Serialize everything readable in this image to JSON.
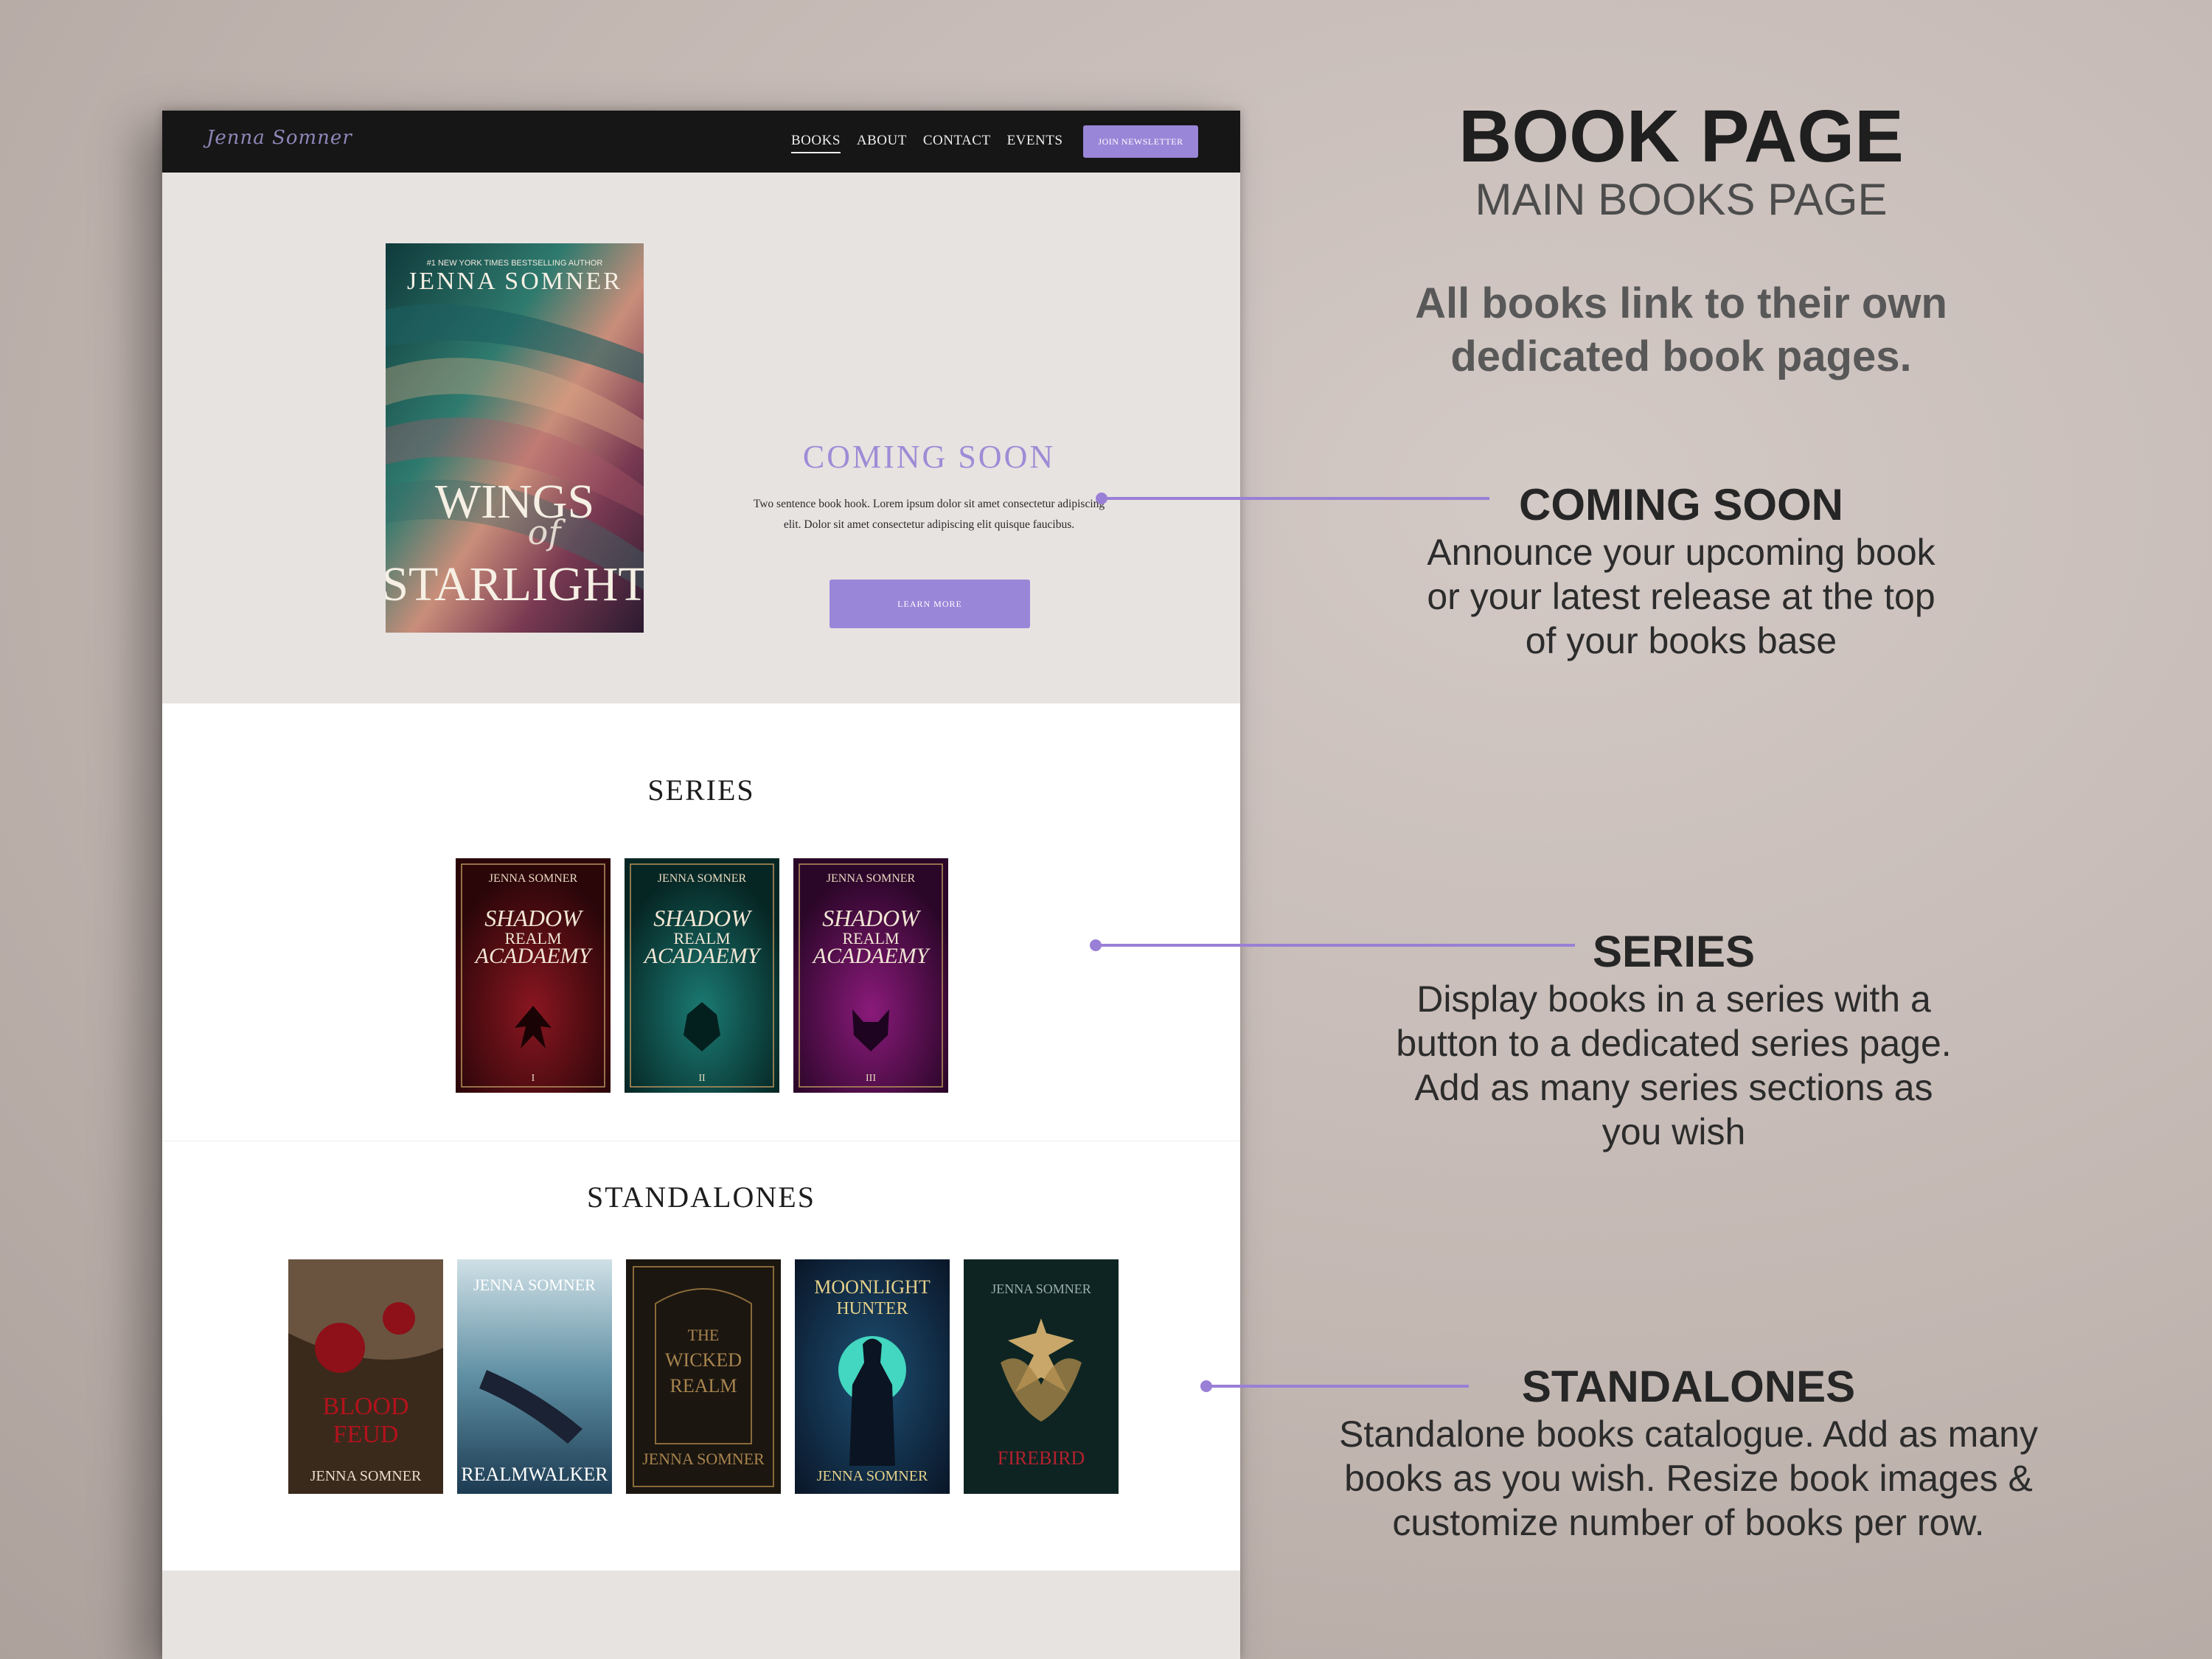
{
  "mockup": {
    "logo": "Jenna Somner",
    "nav": {
      "links": [
        "BOOKS",
        "ABOUT",
        "CONTACT",
        "EVENTS"
      ],
      "cta": "JOIN NEWSLETTER"
    },
    "hero": {
      "cover": {
        "tagline": "#1 NEW YORK TIMES BESTSELLING AUTHOR",
        "author": "JENNA SOMNER",
        "title_top": "WINGS",
        "title_mid": "of",
        "title_bottom": "STARLIGHT"
      },
      "title": "COMING SOON",
      "text": "Two sentence book hook. Lorem ipsum dolor sit amet consectetur adipiscing elit. Dolor sit amet consectetur adipiscing elit quisque faucibus.",
      "button": "LEARN MORE"
    },
    "series": {
      "title": "SERIES",
      "books": [
        {
          "author": "JENNA SOMNER",
          "title": "SHADOW REALM ACADAEMY",
          "numeral": "I"
        },
        {
          "author": "JENNA SOMNER",
          "title": "SHADOW REALM ACADAEMY",
          "numeral": "II"
        },
        {
          "author": "JENNA SOMNER",
          "title": "SHADOW REALM ACADAEMY",
          "numeral": "III"
        }
      ]
    },
    "standalones": {
      "title": "STANDALONES",
      "books": [
        {
          "title": "BLOOD FEUD",
          "author": "JENNA SOMNER"
        },
        {
          "title": "REALMWALKER",
          "author": "JENNA SOMNER"
        },
        {
          "title": "THE WICKED REALM",
          "author": "JENNA SOMNER"
        },
        {
          "title": "MOONLIGHT HUNTER",
          "author": "JENNA SOMNER"
        },
        {
          "title": "FIREBIRD",
          "author": "JENNA SOMNER"
        }
      ]
    }
  },
  "annotations": {
    "title": "BOOK PAGE",
    "subtitle": "MAIN BOOKS PAGE",
    "description": "All books link to their own dedicated book pages.",
    "coming_soon": {
      "heading": "COMING SOON",
      "body": "Announce your upcoming book or your latest release at the top of your books base"
    },
    "series": {
      "heading": "SERIES",
      "body": "Display books in a series with a button to a dedicated series page. Add as many series sections as you wish"
    },
    "standalones": {
      "heading": "STANDALONES",
      "body": "Standalone books catalogue. Add as many books as you wish. Resize book images & customize number of books per row."
    }
  },
  "colors": {
    "accent": "#9a86d8",
    "nav_bg": "#161616",
    "hero_bg": "#e7e3e1",
    "connector": "#9a7fd6"
  }
}
